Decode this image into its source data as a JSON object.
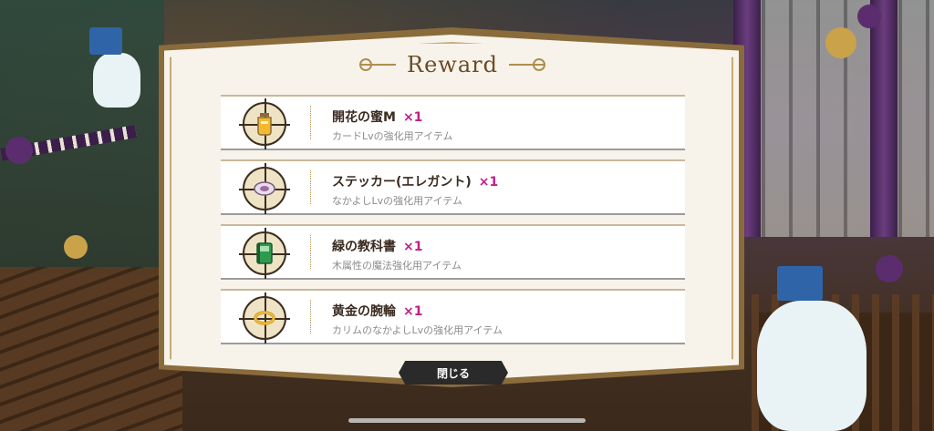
{
  "dialog": {
    "title": "Reward",
    "close_label": "閉じる"
  },
  "rewards": [
    {
      "name": "開花の蜜M",
      "qty": "×1",
      "desc": "カードLvの強化用アイテム",
      "icon": "honey-jar-icon"
    },
    {
      "name": "ステッカー(エレガント)",
      "qty": "×1",
      "desc": "なかよしLvの強化用アイテム",
      "icon": "sticker-icon"
    },
    {
      "name": "緑の教科書",
      "qty": "×1",
      "desc": "木属性の魔法強化用アイテム",
      "icon": "green-textbook-icon"
    },
    {
      "name": "黄金の腕輪",
      "qty": "×1",
      "desc": "カリムのなかよしLvの強化用アイテム",
      "icon": "golden-bracelet-icon"
    }
  ],
  "colors": {
    "quantity": "#c21d8d",
    "panel": "#f7f3ea",
    "frame": "#8a6b3c"
  }
}
